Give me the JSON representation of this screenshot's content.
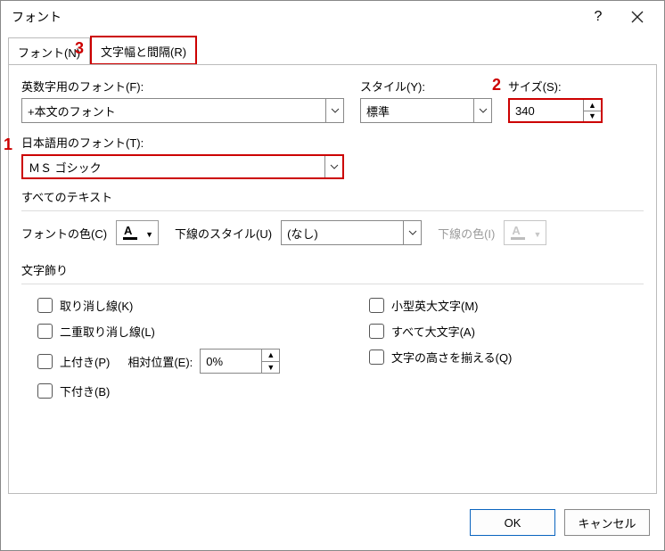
{
  "title": "フォント",
  "tabs": {
    "font": "フォント(N)",
    "spacing": "文字幅と間隔(R)"
  },
  "labels": {
    "latinFont": "英数字用のフォント(F):",
    "style": "スタイル(Y):",
    "size": "サイズ(S):",
    "asianFont": "日本語用のフォント(T):",
    "allText": "すべてのテキスト",
    "fontColor": "フォントの色(C)",
    "underlineStyle": "下線のスタイル(U)",
    "underlineColor": "下線の色(I)",
    "effects": "文字飾り",
    "relativePos": "相対位置(E):"
  },
  "values": {
    "latinFont": "+本文のフォント",
    "style": "標準",
    "size": "340",
    "asianFont": "ＭＳ ゴシック",
    "underlineStyle": "(なし)",
    "relativePos": "0%"
  },
  "checks": {
    "strike": "取り消し線(K)",
    "dstrike": "二重取り消し線(L)",
    "super": "上付き(P)",
    "sub": "下付き(B)",
    "smallcaps": "小型英大文字(M)",
    "allcaps": "すべて大文字(A)",
    "equalize": "文字の高さを揃える(Q)"
  },
  "buttons": {
    "ok": "OK",
    "cancel": "キャンセル"
  },
  "annot": {
    "a1": "1",
    "a2": "2",
    "a3": "3"
  }
}
